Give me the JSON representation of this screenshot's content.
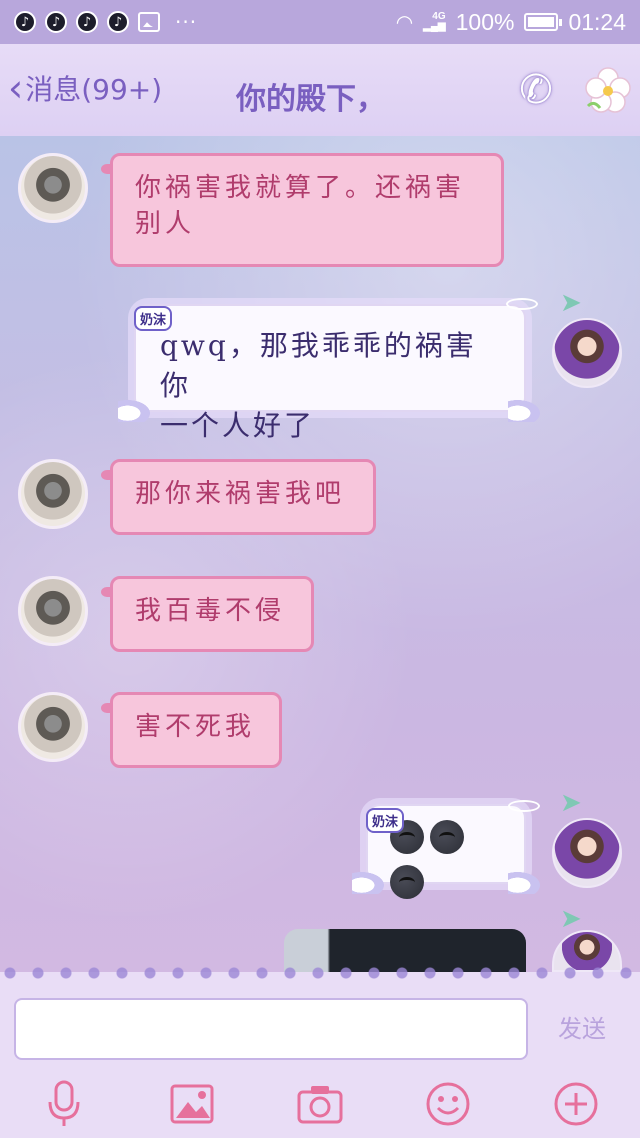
{
  "status_bar": {
    "battery": "100%",
    "time": "01:24",
    "network": "4G",
    "more": "···",
    "icons": [
      "tiktok-icon",
      "tiktok-icon",
      "tiktok-icon",
      "tiktok-icon",
      "image-icon"
    ]
  },
  "header": {
    "back_label": "消息(99+)",
    "title": "你的殿下，",
    "icons": [
      "phone-icon",
      "flower-icon"
    ]
  },
  "messages": [
    {
      "side": "left",
      "text_line1": "你祸害我就算了。还祸害",
      "text_line2": "别人"
    },
    {
      "side": "right",
      "nick": "奶沫",
      "text_line1": "qwq，那我乖乖的祸害你",
      "text_line2": "一个人好了"
    },
    {
      "side": "left",
      "text": "那你来祸害我吧"
    },
    {
      "side": "left",
      "text": "我百毒不侵"
    },
    {
      "side": "left",
      "text": "害不死我"
    },
    {
      "side": "right",
      "nick": "奶沫",
      "emoji": "🌚🌚🌚",
      "emoji_name": "new-moon-face"
    },
    {
      "side": "right",
      "type": "image"
    }
  ],
  "input": {
    "placeholder": "",
    "send_label": "发送"
  },
  "toolbar": [
    "microphone-icon",
    "image-icon",
    "camera-icon",
    "emoji-icon",
    "plus-icon"
  ],
  "colors": {
    "accent": "#7a5fc0",
    "left_bubble_bg": "#f7c6dc",
    "left_bubble_text": "#b03c6c",
    "right_bubble_text": "#3b2d6e",
    "toolbar_icon": "#e6709c"
  }
}
